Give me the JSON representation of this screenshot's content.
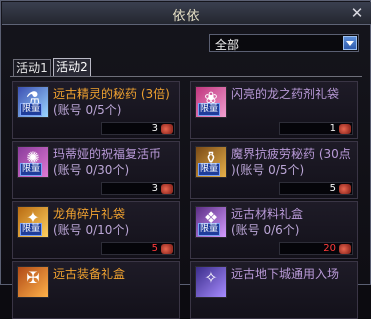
{
  "window": {
    "title": "依依"
  },
  "filter": {
    "selected": "全部"
  },
  "tabs": [
    {
      "label": "活动1",
      "active": false
    },
    {
      "label": "活动2",
      "active": true
    }
  ],
  "items": [
    {
      "name": "远古精灵的秘药 (3倍)",
      "limit": "(账号 0/5个)",
      "qty": "3",
      "qty_color": "white",
      "icon": "potion-bottle-icon",
      "badge": "限量",
      "icon_colors": [
        "#3b4fb2",
        "#9bd6ff"
      ]
    },
    {
      "name": "闪亮的龙之药剂礼袋",
      "limit": "",
      "qty": "1",
      "qty_color": "white",
      "icon": "gift-bag-icon",
      "badge": "限量",
      "icon_colors": [
        "#c0357e",
        "#f1a0d0"
      ]
    },
    {
      "name": "玛蒂娅的祝福复活币",
      "limit": "(账号 0/30个)",
      "qty": "3",
      "qty_color": "white",
      "icon": "revive-coin-icon",
      "badge": "限量",
      "icon_colors": [
        "#8a3b9b",
        "#e07ad4"
      ]
    },
    {
      "name": "魔界抗疲劳秘药 (30点",
      "limit": ")(账号 0/5个)",
      "qty": "5",
      "qty_color": "white",
      "icon": "potion-jar-icon",
      "badge": "限量",
      "icon_colors": [
        "#7a4a16",
        "#e7b14a"
      ]
    },
    {
      "name": "龙角碎片礼袋",
      "limit": "(账号 0/10个)",
      "qty": "5",
      "qty_color": "red",
      "icon": "dragon-horn-bag-icon",
      "badge": "限量",
      "icon_colors": [
        "#b86b12",
        "#ffd060"
      ]
    },
    {
      "name": "远古材料礼盒",
      "limit": "(账号 0/6个)",
      "qty": "20",
      "qty_color": "red",
      "icon": "material-box-icon",
      "badge": "限量",
      "icon_colors": [
        "#5b2d84",
        "#d49cff"
      ]
    },
    {
      "name": "远古装备礼盒",
      "limit": "",
      "qty": "",
      "qty_color": "red",
      "icon": "equipment-box-icon",
      "badge": "",
      "icon_colors": [
        "#b04a16",
        "#ffb24a"
      ]
    },
    {
      "name": "远古地下城通用入场",
      "limit": "",
      "qty": "",
      "qty_color": "red",
      "icon": "dungeon-ticket-icon",
      "badge": "",
      "icon_colors": [
        "#3b2d8a",
        "#a78cff"
      ]
    }
  ]
}
